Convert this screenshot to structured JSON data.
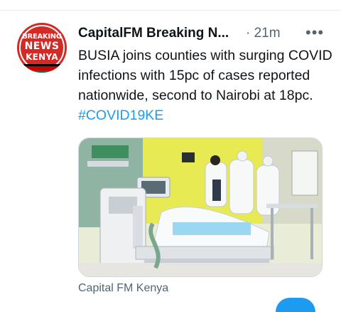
{
  "tweet": {
    "avatar_text": [
      "BREAKING",
      "NEWS",
      "KENYA"
    ],
    "author_name": "CapitalFM Breaking N...",
    "time": "· 21m",
    "more_label": "•••",
    "text_body": "BUSIA joins counties with surging COVID infections with 15pc of cases reported nationwide, second to Nairobi at 18pc. ",
    "hashtag": "#COVID19KE",
    "media_source": "Capital FM Kenya"
  },
  "colors": {
    "accent": "#1d9bf0",
    "secondary_text": "#536471",
    "avatar_red": "#d32a26"
  }
}
